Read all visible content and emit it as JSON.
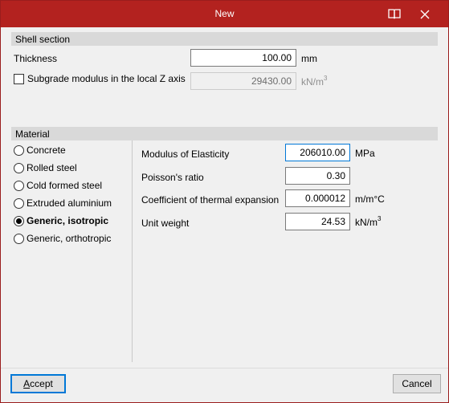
{
  "window": {
    "title": "New",
    "accent_color": "#b3221f",
    "help_icon": "book-icon",
    "close_icon": "close-icon"
  },
  "shell_section": {
    "header": "Shell section",
    "thickness": {
      "label": "Thickness",
      "value": "100.00",
      "unit": "mm"
    },
    "subgrade": {
      "label": "Subgrade modulus in the local Z axis",
      "checked": false,
      "value": "29430.00",
      "unit_base": "kN/m",
      "unit_exp": "3"
    }
  },
  "material": {
    "header": "Material",
    "options": [
      {
        "label": "Concrete",
        "selected": false
      },
      {
        "label": "Rolled steel",
        "selected": false
      },
      {
        "label": "Cold formed steel",
        "selected": false
      },
      {
        "label": "Extruded aluminium",
        "selected": false
      },
      {
        "label": "Generic, isotropic",
        "selected": true
      },
      {
        "label": "Generic, orthotropic",
        "selected": false
      }
    ],
    "properties": {
      "modulus": {
        "label": "Modulus of Elasticity",
        "value": "206010.00",
        "unit": "MPa"
      },
      "poisson": {
        "label": "Poisson's ratio",
        "value": "0.30"
      },
      "thermal": {
        "label": "Coefficient of thermal expansion",
        "value": "0.000012",
        "unit": "m/m°C"
      },
      "weight": {
        "label": "Unit weight",
        "value": "24.53",
        "unit_base": "kN/m",
        "unit_exp": "3"
      }
    }
  },
  "buttons": {
    "accept": {
      "mnemonic": "A",
      "rest": "ccept"
    },
    "cancel": "Cancel"
  }
}
